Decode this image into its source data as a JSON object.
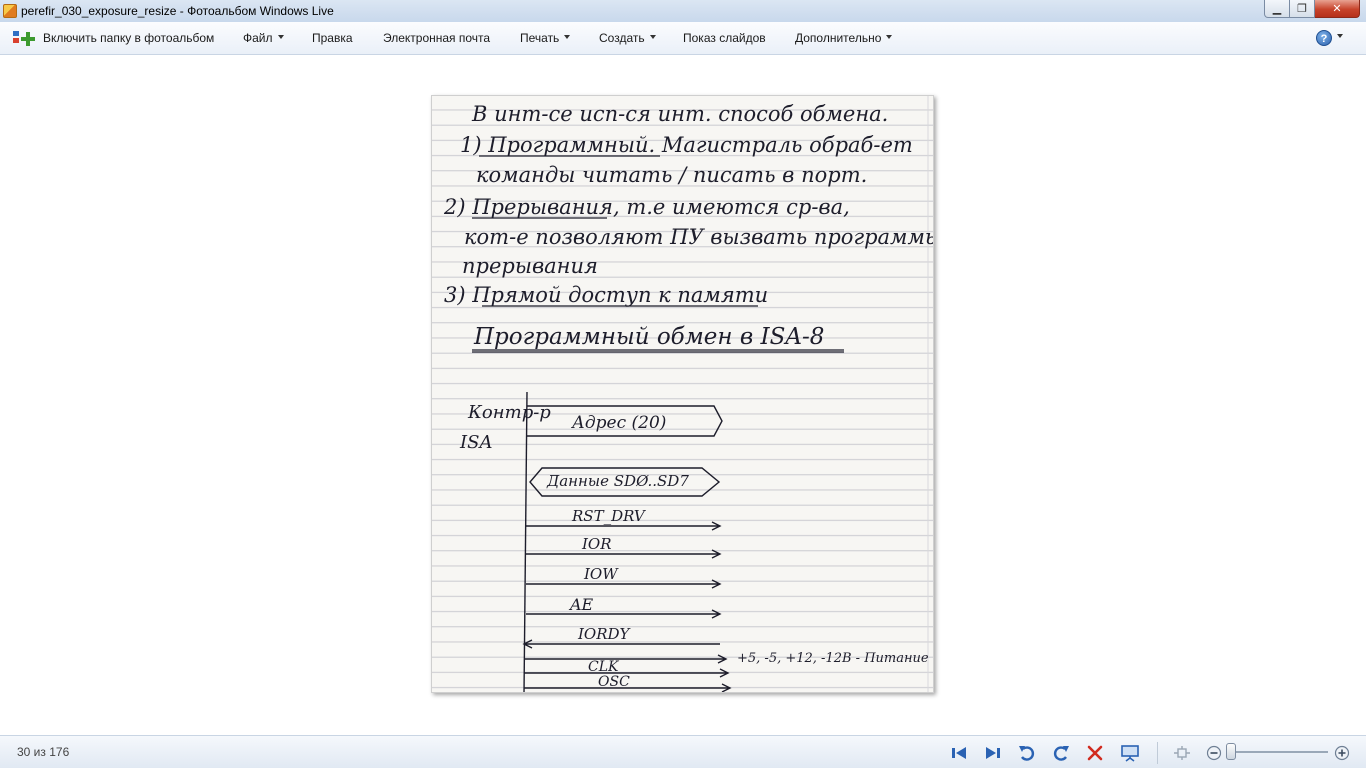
{
  "window": {
    "title": "perefir_030_exposure_resize - Фотоальбом Windows Live",
    "controls": {
      "minimize": "▁",
      "maximize": "❐",
      "close": "✕"
    }
  },
  "menu": {
    "include_folder": "Включить папку в фотоальбом",
    "file": "Файл",
    "edit": "Правка",
    "email": "Электронная почта",
    "print": "Печать",
    "create": "Создать",
    "slideshow": "Показ слайдов",
    "extras": "Дополнительно",
    "help": "?"
  },
  "photo": {
    "icon": "handwritten-notes-photo",
    "lines": [
      "В инт-се исп-ся инт. способ обмена.",
      "1) Программный. Магистраль обраб-ет",
      "команды читать / писать в порт.",
      "2) Прерывания, т.е имеются ср-ва,",
      "кот-е позволяют ПУ вызвать программы",
      "прерывания",
      "3) Прямой доступ к памяти"
    ],
    "heading": "Программный обмен в ISA-8",
    "diagram": {
      "controller": "Контр-р",
      "bus": "ISA",
      "address": "Адрес (20)",
      "data": "Данные SDØ..SD7",
      "signals": [
        "RST_DRV",
        "IOR",
        "IOW",
        "AE",
        "IORDY",
        "CLK",
        "OSC"
      ],
      "power": "+5, -5, +12, -12В - Питание"
    }
  },
  "status": {
    "counter": "30 из 176"
  },
  "colors": {
    "titlebar": "#c8d8ec",
    "accent": "#2c62ad",
    "delete": "#d12b1f",
    "ink": "#1d1d2b"
  }
}
